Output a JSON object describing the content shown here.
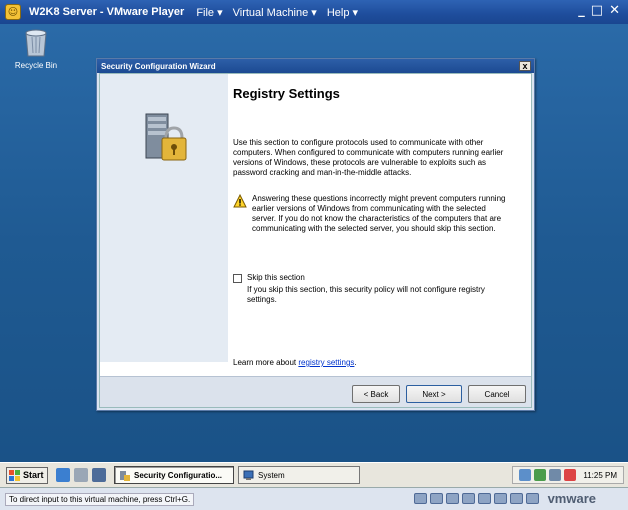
{
  "vmware": {
    "title": "W2K8 Server - VMware Player",
    "menu": [
      "File ▾",
      "Virtual Machine ▾",
      "Help ▾"
    ],
    "window_buttons": {
      "minimize": "_",
      "maximize": "□",
      "close": "✕"
    },
    "status_text": "To direct input to this virtual machine, press Ctrl+G.",
    "logo": "vmware"
  },
  "desktop": {
    "recycle_bin_label": "Recycle Bin"
  },
  "wizard": {
    "window_title": "Security Configuration Wizard",
    "close_glyph": "x",
    "heading": "Registry Settings",
    "intro": "Use this section to configure protocols used to communicate with other computers. When configured to communicate with computers running earlier versions of Windows, these protocols are vulnerable to exploits such as password cracking and man-in-the-middle attacks.",
    "warning": "Answering these questions incorrectly might prevent computers running earlier versions of Windows from communicating with the selected server. If you do not know the characteristics of the computers that are communicating with the selected server, you should skip this section.",
    "skip_label": "Skip this section",
    "skip_checked": false,
    "skip_note": "If you skip this section, this security policy will not configure registry settings.",
    "learn_prefix": "Learn more about ",
    "learn_link": "registry settings",
    "learn_suffix": ".",
    "buttons": {
      "back": "< Back",
      "next": "Next >",
      "cancel": "Cancel"
    }
  },
  "taskbar": {
    "start_label": "Start",
    "tasks": [
      {
        "label": "Security Configuratio...",
        "active": true
      },
      {
        "label": "System",
        "active": false
      }
    ],
    "clock": "11:25 PM"
  },
  "colors": {
    "desktop": "#1f5a92",
    "titlebar": "#1e4d9c",
    "link": "#0033cc"
  }
}
